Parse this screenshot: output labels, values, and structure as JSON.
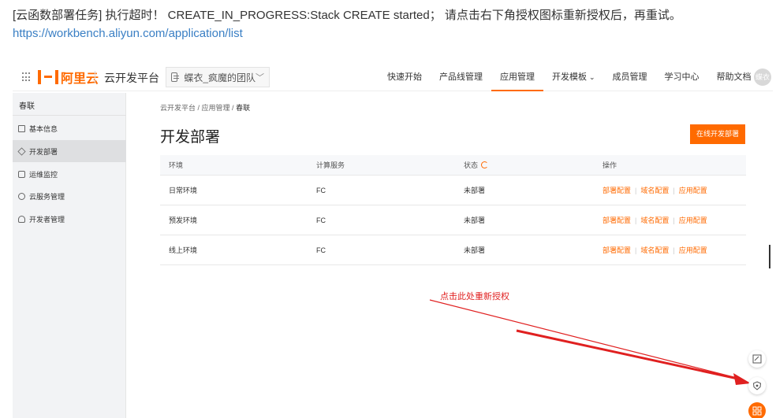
{
  "message": {
    "text": "[云函数部署任务] 执行超时！  CREATE_IN_PROGRESS:Stack CREATE started；  请点击右下角授权图标重新授权后，再重试。",
    "link": "https://workbench.aliyun.com/application/list"
  },
  "header": {
    "logo_text": "阿里云",
    "platform_name": "云开发平台",
    "team_name": "蝶衣_疯魔的团队",
    "nav": [
      {
        "label": "快速开始"
      },
      {
        "label": "产品线管理"
      },
      {
        "label": "应用管理"
      },
      {
        "label": "开发模板"
      },
      {
        "label": "成员管理"
      },
      {
        "label": "学习中心"
      },
      {
        "label": "帮助文档"
      }
    ],
    "avatar_text": "蝶衣"
  },
  "sidebar": {
    "title": "春联",
    "items": [
      {
        "label": "基本信息"
      },
      {
        "label": "开发部署"
      },
      {
        "label": "运维监控"
      },
      {
        "label": "云服务管理"
      },
      {
        "label": "开发者管理"
      }
    ]
  },
  "main": {
    "breadcrumb": [
      "云开发平台",
      "应用管理",
      "春联"
    ],
    "title": "开发部署",
    "deploy_button": "在线开发部署",
    "table": {
      "headers": [
        "环境",
        "计算服务",
        "状态",
        "操作"
      ],
      "rows": [
        {
          "env": "日常环境",
          "service": "FC",
          "status": "未部署"
        },
        {
          "env": "预发环境",
          "service": "FC",
          "status": "未部署"
        },
        {
          "env": "线上环境",
          "service": "FC",
          "status": "未部署"
        }
      ],
      "actions": [
        "部署配置",
        "域名配置",
        "应用配置"
      ]
    }
  },
  "annotation": {
    "hint": "点击此处重新授权",
    "color": "#e02020"
  },
  "colors": {
    "accent": "#ff6a00",
    "link": "#3a7fc4"
  }
}
